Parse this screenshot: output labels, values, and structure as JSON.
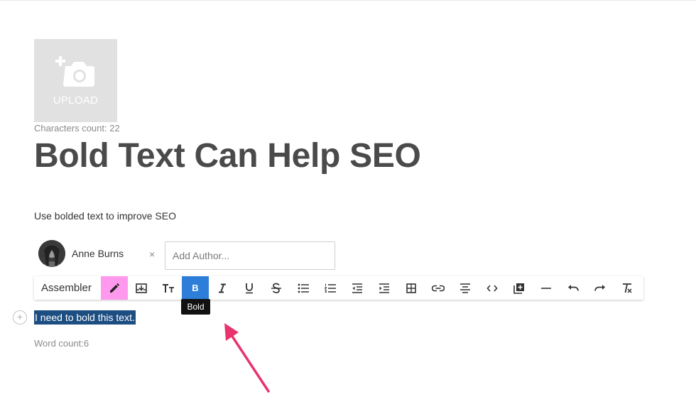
{
  "upload": {
    "label": "UPLOAD",
    "icon": "add-photo-icon"
  },
  "characters_count": "Characters count: 22",
  "title": "Bold Text Can Help SEO",
  "subtitle": "Use bolded text to improve SEO",
  "author": {
    "name": "Anne Burns",
    "remove_label": "×",
    "input_placeholder": "Add Author..."
  },
  "toolbar": {
    "label": "Assembler",
    "buttons": [
      {
        "name": "edit-icon",
        "active": "pink"
      },
      {
        "name": "download-icon"
      },
      {
        "name": "text-size-icon"
      },
      {
        "name": "bold-icon",
        "active": "blue",
        "text": "B"
      },
      {
        "name": "italic-icon"
      },
      {
        "name": "underline-icon"
      },
      {
        "name": "strikethrough-icon"
      },
      {
        "name": "bulleted-list-icon"
      },
      {
        "name": "numbered-list-icon"
      },
      {
        "name": "outdent-icon"
      },
      {
        "name": "indent-icon"
      },
      {
        "name": "table-icon"
      },
      {
        "name": "link-icon"
      },
      {
        "name": "align-center-icon"
      },
      {
        "name": "code-icon"
      },
      {
        "name": "add-block-icon"
      },
      {
        "name": "horizontal-rule-icon"
      },
      {
        "name": "undo-icon"
      },
      {
        "name": "redo-icon"
      },
      {
        "name": "clear-formatting-icon"
      }
    ],
    "tooltip": "Bold"
  },
  "editor": {
    "add_symbol": "+",
    "selected_text": "I need to bold this text."
  },
  "word_count": "Word count:6",
  "colors": {
    "highlight_pink": "#ff99ee",
    "active_blue": "#2d7ed9",
    "selection": "#1d4e82",
    "arrow": "#e8336d"
  }
}
